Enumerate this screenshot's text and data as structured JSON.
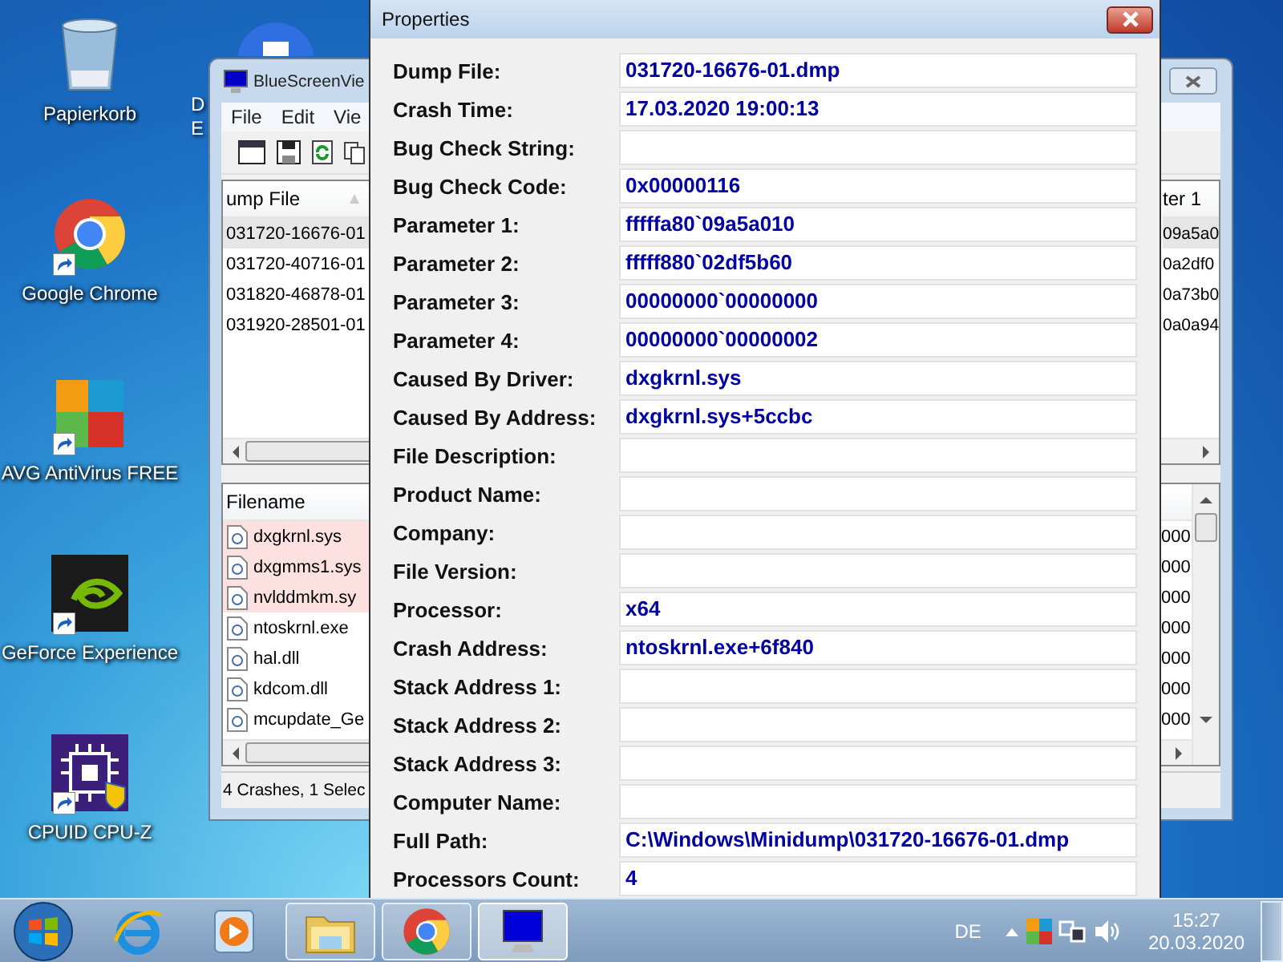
{
  "desktop_icons": [
    {
      "label": "Papierkorb",
      "kind": "trash",
      "shortcut": false
    },
    {
      "label": "Google Chrome",
      "kind": "chrome",
      "shortcut": true
    },
    {
      "label": "AVG AntiVirus FREE",
      "kind": "avg",
      "shortcut": true
    },
    {
      "label": "GeForce Experience",
      "kind": "nvidia",
      "shortcut": true
    },
    {
      "label": "CPUID CPU-Z",
      "kind": "cpu",
      "shortcut": true
    }
  ],
  "partial_icon": {
    "label_lines": [
      "D",
      "E"
    ]
  },
  "background_window": {
    "title": "BlueScreenVie",
    "menu": [
      "File",
      "Edit",
      "Vie"
    ],
    "crash_list": {
      "column_1": "ump File",
      "column_2": "ter 1",
      "rows": [
        {
          "dump_file": "031720-16676-01",
          "parameter": "09a5a0",
          "selected": true
        },
        {
          "dump_file": "031720-40716-01",
          "parameter": "0a2df0",
          "selected": false
        },
        {
          "dump_file": "031820-46878-01",
          "parameter": "0a73b0",
          "selected": false
        },
        {
          "dump_file": "031920-28501-01",
          "parameter": "0a0a94",
          "selected": false
        }
      ]
    },
    "driver_list": {
      "column_1": "Filename",
      "rows": [
        {
          "filename": "dxgkrnl.sys",
          "column_2": "000",
          "highlighted": true
        },
        {
          "filename": "dxgmms1.sys",
          "column_2": "000",
          "highlighted": true
        },
        {
          "filename": "nvlddmkm.sy",
          "column_2": "000",
          "highlighted": true
        },
        {
          "filename": "ntoskrnl.exe",
          "column_2": "000",
          "highlighted": false
        },
        {
          "filename": "hal.dll",
          "column_2": "000",
          "highlighted": false
        },
        {
          "filename": "kdcom.dll",
          "column_2": "000",
          "highlighted": false
        },
        {
          "filename": "mcupdate_Ge",
          "column_2": "000",
          "highlighted": false
        }
      ]
    },
    "status_bar": "4 Crashes, 1 Selec"
  },
  "properties": {
    "title": "Properties",
    "fields": [
      {
        "label": "Dump File:",
        "value": "031720-16676-01.dmp"
      },
      {
        "label": "Crash Time:",
        "value": "17.03.2020 19:00:13"
      },
      {
        "label": "Bug Check String:"
      },
      {
        "label": "Bug Check Code:",
        "value": "0x00000116"
      },
      {
        "label": "Parameter 1:",
        "value": "fffffa80`09a5a010"
      },
      {
        "label": "Parameter 2:",
        "value": "fffff880`02df5b60"
      },
      {
        "label": "Parameter 3:",
        "value": "00000000`00000000"
      },
      {
        "label": "Parameter 4:",
        "value": "00000000`00000002"
      },
      {
        "label": "Caused By Driver:",
        "value": "dxgkrnl.sys"
      },
      {
        "label": "Caused By Address:",
        "value": "dxgkrnl.sys+5ccbc"
      },
      {
        "label": "File Description:"
      },
      {
        "label": "Product Name:"
      },
      {
        "label": "Company:"
      },
      {
        "label": "File Version:"
      },
      {
        "label": "Processor:",
        "value": "x64"
      },
      {
        "label": "Crash Address:",
        "value": "ntoskrnl.exe+6f840"
      },
      {
        "label": "Stack Address 1:"
      },
      {
        "label": "Stack Address 2:"
      },
      {
        "label": "Stack Address 3:"
      },
      {
        "label": "Computer Name:"
      },
      {
        "label": "Full Path:",
        "value": "C:\\Windows\\Minidump\\031720-16676-01.dmp"
      },
      {
        "label": "Processors Count:",
        "value": "4"
      }
    ]
  },
  "taskbar": {
    "apps": [
      {
        "kind": "ie",
        "running": false,
        "selected": false
      },
      {
        "kind": "media",
        "running": false,
        "selected": false
      },
      {
        "kind": "folder",
        "running": true,
        "selected": false
      },
      {
        "kind": "chrome",
        "running": true,
        "selected": false
      },
      {
        "kind": "monitor",
        "running": true,
        "selected": true
      }
    ],
    "language": "DE",
    "time": "15:27",
    "date": "20.03.2020"
  }
}
